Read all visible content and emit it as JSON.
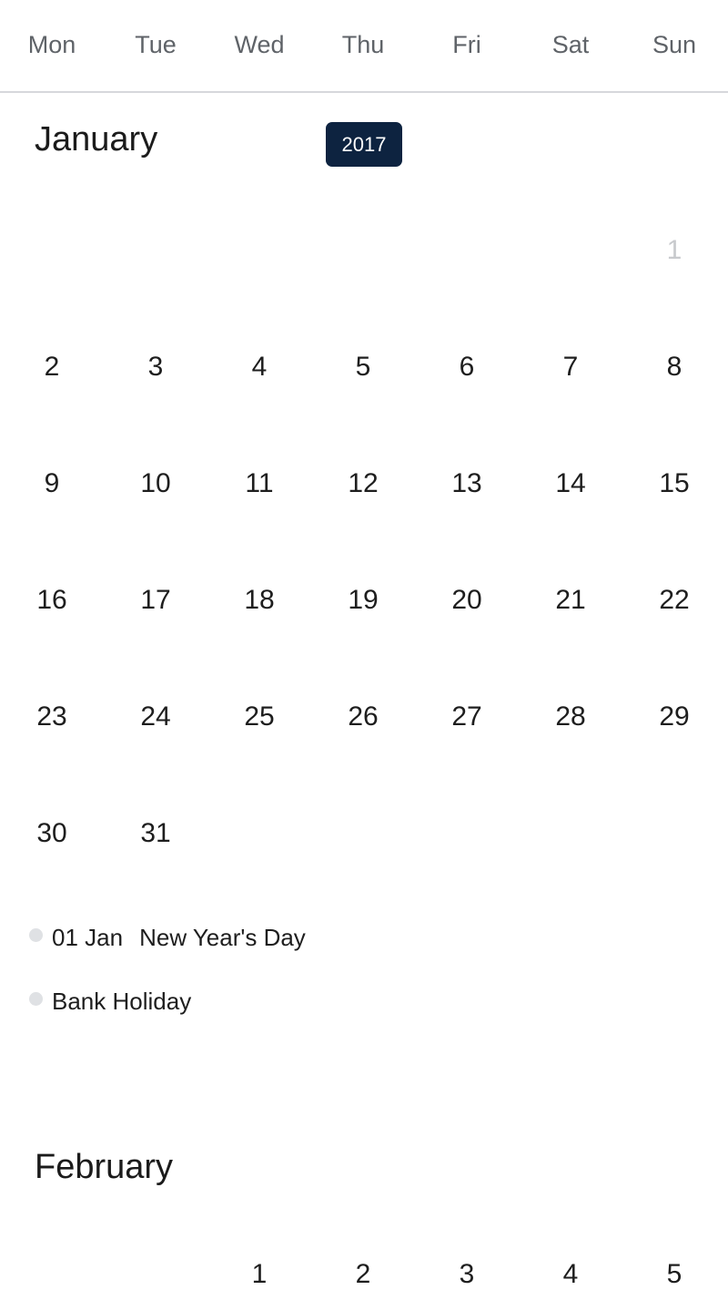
{
  "weekdays": [
    "Mon",
    "Tue",
    "Wed",
    "Thu",
    "Fri",
    "Sat",
    "Sun"
  ],
  "january": {
    "title": "January",
    "year": "2017",
    "weeks": [
      [
        "",
        "",
        "",
        "",
        "",
        "",
        "1"
      ],
      [
        "2",
        "3",
        "4",
        "5",
        "6",
        "7",
        "8"
      ],
      [
        "9",
        "10",
        "11",
        "12",
        "13",
        "14",
        "15"
      ],
      [
        "16",
        "17",
        "18",
        "19",
        "20",
        "21",
        "22"
      ],
      [
        "23",
        "24",
        "25",
        "26",
        "27",
        "28",
        "29"
      ],
      [
        "30",
        "31",
        "",
        "",
        "",
        "",
        ""
      ]
    ],
    "holidays": [
      {
        "date": "01 Jan",
        "name": "New Year's Day"
      },
      {
        "date": "",
        "name": "Bank Holiday"
      }
    ]
  },
  "february": {
    "title": "February",
    "first_week": [
      "",
      "",
      "1",
      "2",
      "3",
      "4",
      "5"
    ]
  },
  "colors": {
    "accent": "#0d2340",
    "text": "#1e1e1e",
    "muted_day": "#c8cacd",
    "header_text": "#5f6368",
    "divider": "#d6d8dc"
  }
}
